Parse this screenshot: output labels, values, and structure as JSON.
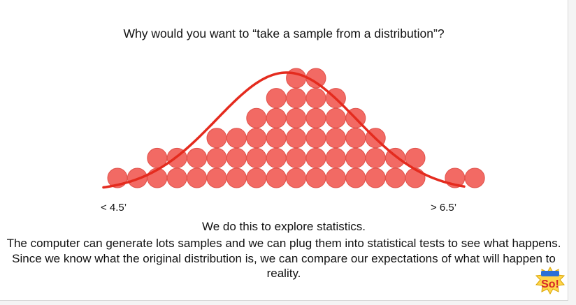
{
  "slide": {
    "title": "Why would you want to “take a sample from a distribution”?",
    "left_label": "< 4.5’",
    "right_label": "> 6.5’",
    "explanation_line1": "We do this to explore statistics.",
    "explanation_body": "The computer can generate lots samples and we can plug them into statistical tests to see what happens. Since we know what the original distribution is, we can compare our expectations of what will happen to reality."
  },
  "figure": {
    "column_counts": [
      1,
      1,
      2,
      2,
      2,
      3,
      3,
      4,
      5,
      6,
      6,
      5,
      4,
      3,
      2,
      2,
      0,
      1,
      1
    ],
    "ball_color": "#f26a64",
    "ball_stroke": "#e0514a",
    "curve_color": "#e42b1e"
  },
  "logo": {
    "name": "so-logo-icon",
    "text": "So!"
  }
}
